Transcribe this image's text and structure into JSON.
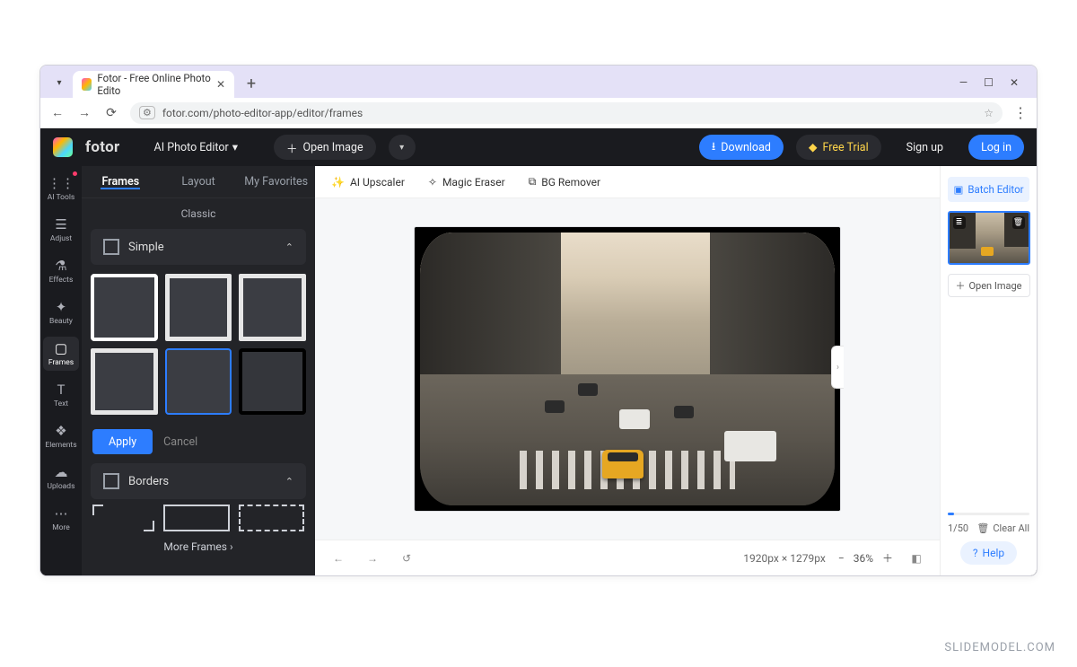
{
  "browser": {
    "tab_title": "Fotor - Free Online Photo Edito",
    "url": "fotor.com/photo-editor-app/editor/frames"
  },
  "header": {
    "logo_text": "fotor",
    "ai_editor_label": "AI Photo Editor",
    "open_image_label": "Open Image",
    "download_label": "Download",
    "free_trial_label": "Free Trial",
    "sign_up_label": "Sign up",
    "log_in_label": "Log in"
  },
  "rail": {
    "items": [
      {
        "id": "ai-tools",
        "label": "AI Tools",
        "icon": "⋮⋮",
        "badge": true
      },
      {
        "id": "adjust",
        "label": "Adjust",
        "icon": "☰"
      },
      {
        "id": "effects",
        "label": "Effects",
        "icon": "⚗"
      },
      {
        "id": "beauty",
        "label": "Beauty",
        "icon": "✦"
      },
      {
        "id": "frames",
        "label": "Frames",
        "icon": "▢",
        "active": true
      },
      {
        "id": "text",
        "label": "Text",
        "icon": "T"
      },
      {
        "id": "elements",
        "label": "Elements",
        "icon": "❖"
      },
      {
        "id": "uploads",
        "label": "Uploads",
        "icon": "☁"
      },
      {
        "id": "more",
        "label": "More",
        "icon": "⋯"
      }
    ]
  },
  "panel": {
    "tabs": {
      "frames": "Frames",
      "layout": "Layout",
      "favorites": "My Favorites"
    },
    "category": "Classic",
    "section_simple": "Simple",
    "section_borders": "Borders",
    "apply_label": "Apply",
    "cancel_label": "Cancel",
    "more_frames_label": "More Frames"
  },
  "toolbar": {
    "ai_upscaler": "AI Upscaler",
    "magic_eraser": "Magic Eraser",
    "bg_remover": "BG Remover"
  },
  "canvas_footer": {
    "dimensions": "1920px × 1279px",
    "zoom": "36%"
  },
  "right": {
    "batch_editor": "Batch Editor",
    "open_image": "Open Image",
    "counter": "1/50",
    "clear_all": "Clear All",
    "help": "Help"
  },
  "watermark": "SLIDEMODEL.COM"
}
